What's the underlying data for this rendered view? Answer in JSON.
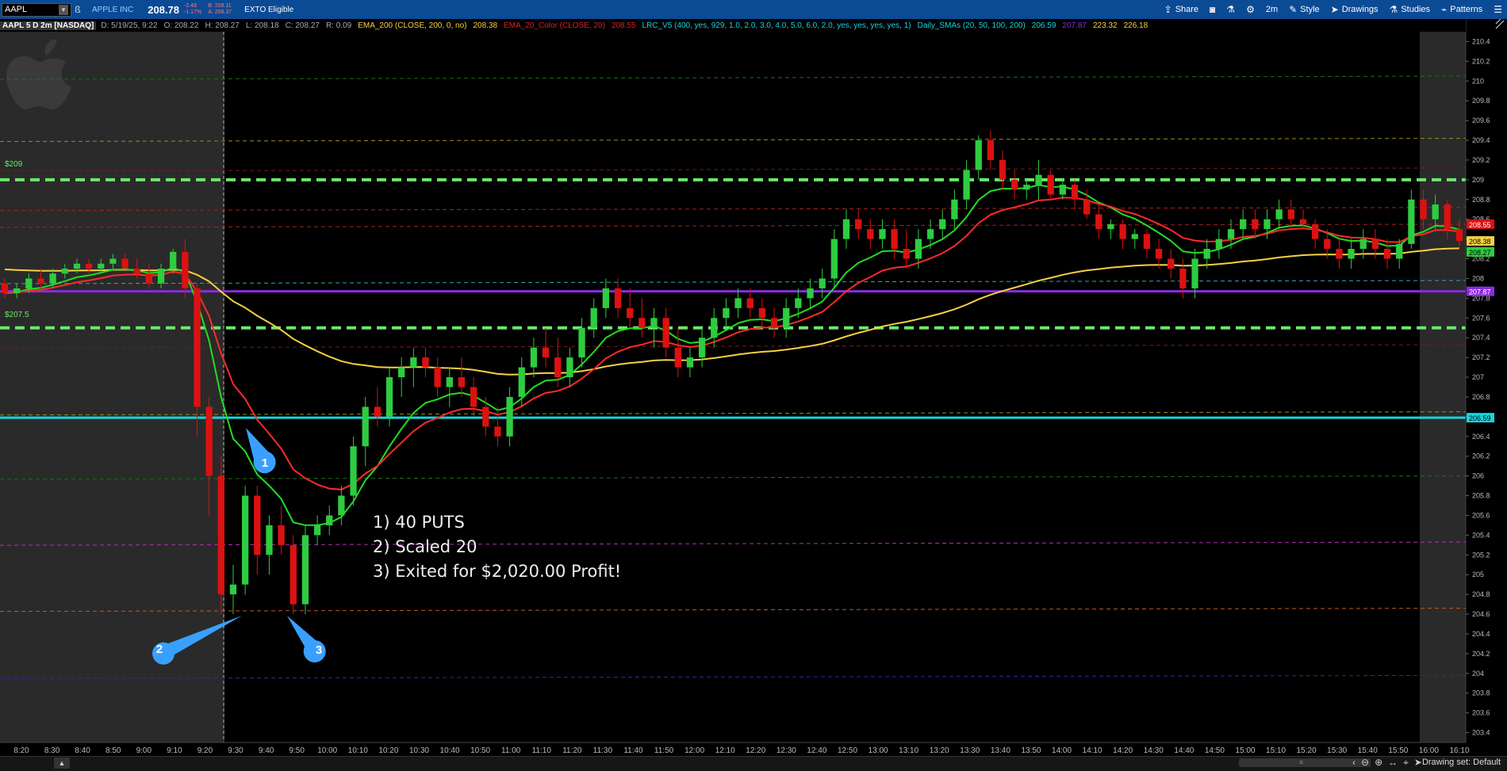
{
  "toolbar": {
    "symbol": "AAPL",
    "company": "APPLE INC",
    "last": "208.78",
    "change": "-2.48",
    "change_pct": "-1.17%",
    "bid": "B: 208.11",
    "ask": "A: 208.37",
    "exto": "EXTO Eligible",
    "share": "Share",
    "timeframe": "2m",
    "style": "Style",
    "drawings": "Drawings",
    "studies": "Studies",
    "patterns": "Patterns"
  },
  "infobar": {
    "symbol": "AAPL 5 D 2m [NASDAQ]",
    "date": "D: 5/19/25, 9:22",
    "open": "O: 208.22",
    "high": "H: 208.27",
    "low": "L: 208.18",
    "close": "C: 208.27",
    "range": "R: 0.09",
    "ema200": "EMA_200 (CLOSE, 200, 0, no)",
    "ema200_val": "208.38",
    "ema20": "EMA_20_Color (CLOSE, 20)",
    "ema20_val": "208.55",
    "lrc": "LRC_V5 (400, yes, 929, 1.0, 2.0, 3.0, 4.0, 5.0, 6.0, 2.0, yes, yes, yes, yes, 1)",
    "smas": "Daily_SMAs (20, 50, 100, 200)",
    "sma20": "206.59",
    "sma50": "207.87",
    "sma100": "223.32",
    "sma200": "226.18"
  },
  "levels": {
    "l209": "$209",
    "l2075": "$207.5"
  },
  "annotation": {
    "line1": "1) 40 PUTS",
    "line2": "2) Scaled 20",
    "line3": "3) Exited for $2,020.00 Profit!"
  },
  "callouts": [
    "1",
    "2",
    "3"
  ],
  "bottom": {
    "drawing_set": "Drawing set: Default"
  },
  "colors": {
    "up": "#2ecc40",
    "down": "#dd1111",
    "ema20": "#ff2a2a",
    "ema200": "#f5d142",
    "fast": "#22dd22",
    "sma_cyan": "#16d4e0",
    "sma_purple": "#8a2be2",
    "callout": "#3aa0ff"
  },
  "chart_data": {
    "type": "candlestick",
    "ylim": [
      203.3,
      210.5
    ],
    "y_ticks": [
      203.4,
      203.6,
      203.8,
      204,
      204.2,
      204.4,
      204.6,
      204.8,
      205,
      205.2,
      205.4,
      205.6,
      205.8,
      206,
      206.2,
      206.4,
      206.6,
      206.8,
      207,
      207.2,
      207.4,
      207.6,
      207.8,
      208,
      208.2,
      208.4,
      208.6,
      208.8,
      209,
      209.2,
      209.4,
      209.6,
      209.8,
      210,
      210.2,
      210.4
    ],
    "x_labels": [
      "8:20",
      "8:30",
      "8:40",
      "8:50",
      "9:00",
      "9:10",
      "9:20",
      "9:30",
      "9:40",
      "9:50",
      "10:00",
      "10:10",
      "10:20",
      "10:30",
      "10:40",
      "10:50",
      "11:00",
      "11:10",
      "11:20",
      "11:30",
      "11:40",
      "11:50",
      "12:00",
      "12:10",
      "12:20",
      "12:30",
      "12:40",
      "12:50",
      "13:00",
      "13:10",
      "13:20",
      "13:30",
      "13:40",
      "13:50",
      "14:00",
      "14:10",
      "14:20",
      "14:30",
      "14:40",
      "14:50",
      "15:00",
      "15:10",
      "15:20",
      "15:30",
      "15:40",
      "15:50",
      "16:00",
      "16:10"
    ],
    "price_tags": [
      {
        "value": 208.55,
        "label": "208.55",
        "bg": "#dd1111",
        "fg": "#ffffff"
      },
      {
        "value": 208.38,
        "label": "208.38",
        "bg": "#f5d142",
        "fg": "#000000"
      },
      {
        "value": 208.27,
        "label": "208.27",
        "bg": "#2ecc40",
        "fg": "#000000"
      },
      {
        "value": 207.87,
        "label": "207.87",
        "bg": "#8a2be2",
        "fg": "#ffffff"
      },
      {
        "value": 206.59,
        "label": "206.59",
        "bg": "#16d4e0",
        "fg": "#000000"
      }
    ],
    "horizontal_levels": [
      {
        "value": 209.0,
        "color": "#6be86b",
        "style": "dash-thick"
      },
      {
        "value": 207.5,
        "color": "#6be86b",
        "style": "dash-thick"
      },
      {
        "value": 207.87,
        "color": "#8a2be2",
        "style": "solid"
      },
      {
        "value": 206.59,
        "color": "#16d4e0",
        "style": "solid"
      }
    ],
    "channel_lines": [
      {
        "value": 210.05,
        "color": "#1d6e1d"
      },
      {
        "value": 209.42,
        "color": "#a08a1a"
      },
      {
        "value": 209.12,
        "color": "#7a1a1a"
      },
      {
        "value": 208.72,
        "color": "#aa2020"
      },
      {
        "value": 208.55,
        "color": "#aa2020"
      },
      {
        "value": 207.98,
        "color": "#2aaaba"
      },
      {
        "value": 207.33,
        "color": "#7a1a1a"
      },
      {
        "value": 206.65,
        "color": "#a08a1a"
      },
      {
        "value": 206.0,
        "color": "#1d6e1d"
      },
      {
        "value": 205.33,
        "color": "#b030b0"
      },
      {
        "value": 204.66,
        "color": "#c05a20"
      },
      {
        "value": 203.98,
        "color": "#2a2ab0"
      }
    ],
    "candles": [
      [
        207.95,
        208.0,
        207.8,
        207.85
      ],
      [
        207.85,
        207.95,
        207.8,
        207.9
      ],
      [
        207.9,
        208.05,
        207.85,
        208.0
      ],
      [
        208.0,
        208.1,
        207.9,
        207.95
      ],
      [
        207.95,
        208.1,
        207.9,
        208.05
      ],
      [
        208.05,
        208.15,
        208.0,
        208.1
      ],
      [
        208.1,
        208.2,
        208.05,
        208.15
      ],
      [
        208.15,
        208.2,
        208.05,
        208.1
      ],
      [
        208.1,
        208.2,
        208.05,
        208.15
      ],
      [
        208.15,
        208.25,
        208.1,
        208.2
      ],
      [
        208.2,
        208.25,
        208.1,
        208.1
      ],
      [
        208.1,
        208.2,
        208.0,
        208.05
      ],
      [
        208.05,
        208.15,
        207.9,
        207.95
      ],
      [
        207.95,
        208.15,
        207.9,
        208.1
      ],
      [
        208.1,
        208.3,
        208.05,
        208.27
      ],
      [
        208.27,
        208.4,
        207.8,
        207.9
      ],
      [
        207.9,
        207.95,
        206.4,
        206.7
      ],
      [
        206.7,
        206.8,
        205.6,
        206.0
      ],
      [
        206.0,
        206.2,
        204.6,
        204.8
      ],
      [
        204.8,
        205.1,
        204.6,
        204.9
      ],
      [
        204.9,
        205.9,
        204.8,
        205.8
      ],
      [
        205.8,
        205.9,
        205.0,
        205.2
      ],
      [
        205.2,
        205.6,
        205.0,
        205.5
      ],
      [
        205.5,
        205.7,
        205.2,
        205.3
      ],
      [
        205.3,
        205.4,
        204.6,
        204.7
      ],
      [
        204.7,
        205.5,
        204.6,
        205.4
      ],
      [
        205.4,
        205.6,
        205.3,
        205.5
      ],
      [
        205.5,
        205.7,
        205.4,
        205.6
      ],
      [
        205.6,
        205.9,
        205.5,
        205.8
      ],
      [
        205.8,
        206.4,
        205.7,
        206.3
      ],
      [
        206.3,
        206.8,
        206.1,
        206.7
      ],
      [
        206.7,
        206.9,
        206.5,
        206.6
      ],
      [
        206.6,
        207.1,
        206.5,
        207.0
      ],
      [
        207.0,
        207.2,
        206.8,
        207.1
      ],
      [
        207.1,
        207.3,
        206.9,
        207.2
      ],
      [
        207.2,
        207.3,
        207.0,
        207.1
      ],
      [
        207.1,
        207.2,
        206.8,
        206.9
      ],
      [
        206.9,
        207.1,
        206.7,
        207.0
      ],
      [
        207.0,
        207.2,
        206.8,
        206.9
      ],
      [
        206.9,
        207.0,
        206.6,
        206.7
      ],
      [
        206.7,
        206.8,
        206.4,
        206.5
      ],
      [
        206.5,
        206.7,
        206.3,
        206.4
      ],
      [
        206.4,
        206.9,
        206.3,
        206.8
      ],
      [
        206.8,
        207.2,
        206.7,
        207.1
      ],
      [
        207.1,
        207.4,
        207.0,
        207.3
      ],
      [
        207.3,
        207.5,
        207.1,
        207.2
      ],
      [
        207.2,
        207.4,
        206.9,
        207.0
      ],
      [
        207.0,
        207.3,
        206.9,
        207.2
      ],
      [
        207.2,
        207.6,
        207.1,
        207.5
      ],
      [
        207.5,
        207.8,
        207.4,
        207.7
      ],
      [
        207.7,
        208.0,
        207.6,
        207.9
      ],
      [
        207.9,
        208.0,
        207.6,
        207.7
      ],
      [
        207.7,
        207.9,
        207.5,
        207.6
      ],
      [
        207.6,
        207.8,
        207.4,
        207.5
      ],
      [
        207.5,
        207.7,
        207.3,
        207.6
      ],
      [
        207.6,
        207.7,
        207.2,
        207.3
      ],
      [
        207.3,
        207.5,
        207.0,
        207.1
      ],
      [
        207.1,
        207.3,
        207.0,
        207.2
      ],
      [
        207.2,
        207.5,
        207.1,
        207.4
      ],
      [
        207.4,
        207.7,
        207.3,
        207.6
      ],
      [
        207.6,
        207.8,
        207.5,
        207.7
      ],
      [
        207.7,
        207.9,
        207.6,
        207.8
      ],
      [
        207.8,
        207.9,
        207.6,
        207.7
      ],
      [
        207.7,
        207.8,
        207.5,
        207.6
      ],
      [
        207.6,
        207.7,
        207.4,
        207.5
      ],
      [
        207.5,
        207.8,
        207.4,
        207.7
      ],
      [
        207.7,
        207.9,
        207.6,
        207.8
      ],
      [
        207.8,
        208.0,
        207.7,
        207.9
      ],
      [
        207.9,
        208.1,
        207.8,
        208.0
      ],
      [
        208.0,
        208.5,
        207.9,
        208.4
      ],
      [
        208.4,
        208.7,
        208.3,
        208.6
      ],
      [
        208.6,
        208.7,
        208.4,
        208.5
      ],
      [
        208.5,
        208.6,
        208.3,
        208.4
      ],
      [
        208.4,
        208.6,
        208.3,
        208.5
      ],
      [
        208.5,
        208.6,
        208.2,
        208.3
      ],
      [
        208.3,
        208.5,
        208.1,
        208.2
      ],
      [
        208.2,
        208.5,
        208.1,
        208.4
      ],
      [
        208.4,
        208.6,
        208.3,
        208.5
      ],
      [
        208.5,
        208.7,
        208.4,
        208.6
      ],
      [
        208.6,
        208.9,
        208.5,
        208.8
      ],
      [
        208.8,
        209.2,
        208.7,
        209.1
      ],
      [
        209.1,
        209.45,
        209.0,
        209.4
      ],
      [
        209.4,
        209.5,
        209.1,
        209.2
      ],
      [
        209.2,
        209.3,
        208.9,
        209.0
      ],
      [
        209.0,
        209.1,
        208.8,
        208.9
      ],
      [
        208.9,
        209.0,
        208.8,
        208.95
      ],
      [
        208.95,
        209.2,
        208.8,
        209.05
      ],
      [
        209.05,
        209.1,
        208.8,
        208.85
      ],
      [
        208.85,
        209.0,
        208.8,
        208.95
      ],
      [
        208.95,
        209.0,
        208.7,
        208.8
      ],
      [
        208.8,
        208.9,
        208.6,
        208.65
      ],
      [
        208.65,
        208.75,
        208.4,
        208.5
      ],
      [
        208.5,
        208.6,
        208.4,
        208.55
      ],
      [
        208.55,
        208.6,
        208.3,
        208.4
      ],
      [
        208.4,
        208.5,
        208.3,
        208.45
      ],
      [
        208.45,
        208.5,
        208.2,
        208.3
      ],
      [
        208.3,
        208.4,
        208.1,
        208.2
      ],
      [
        208.2,
        208.3,
        208.0,
        208.1
      ],
      [
        208.1,
        208.2,
        207.8,
        207.9
      ],
      [
        207.9,
        208.3,
        207.8,
        208.2
      ],
      [
        208.2,
        208.4,
        208.1,
        208.3
      ],
      [
        208.3,
        208.5,
        208.2,
        208.4
      ],
      [
        208.4,
        208.6,
        208.3,
        208.5
      ],
      [
        208.5,
        208.7,
        208.4,
        208.6
      ],
      [
        208.6,
        208.7,
        208.4,
        208.5
      ],
      [
        208.5,
        208.7,
        208.4,
        208.6
      ],
      [
        208.6,
        208.8,
        208.5,
        208.7
      ],
      [
        208.7,
        208.8,
        208.5,
        208.6
      ],
      [
        208.6,
        208.7,
        208.5,
        208.55
      ],
      [
        208.55,
        208.6,
        208.3,
        208.4
      ],
      [
        208.4,
        208.5,
        208.2,
        208.3
      ],
      [
        208.3,
        208.4,
        208.1,
        208.2
      ],
      [
        208.2,
        208.4,
        208.1,
        208.3
      ],
      [
        208.3,
        208.5,
        208.2,
        208.4
      ],
      [
        208.4,
        208.5,
        208.2,
        208.3
      ],
      [
        208.3,
        208.4,
        208.1,
        208.2
      ],
      [
        208.2,
        208.4,
        208.1,
        208.35
      ],
      [
        208.35,
        208.9,
        208.3,
        208.8
      ],
      [
        208.8,
        208.9,
        208.5,
        208.6
      ],
      [
        208.6,
        208.85,
        208.5,
        208.75
      ],
      [
        208.75,
        208.8,
        208.4,
        208.5
      ],
      [
        208.5,
        208.6,
        208.3,
        208.38
      ]
    ]
  }
}
